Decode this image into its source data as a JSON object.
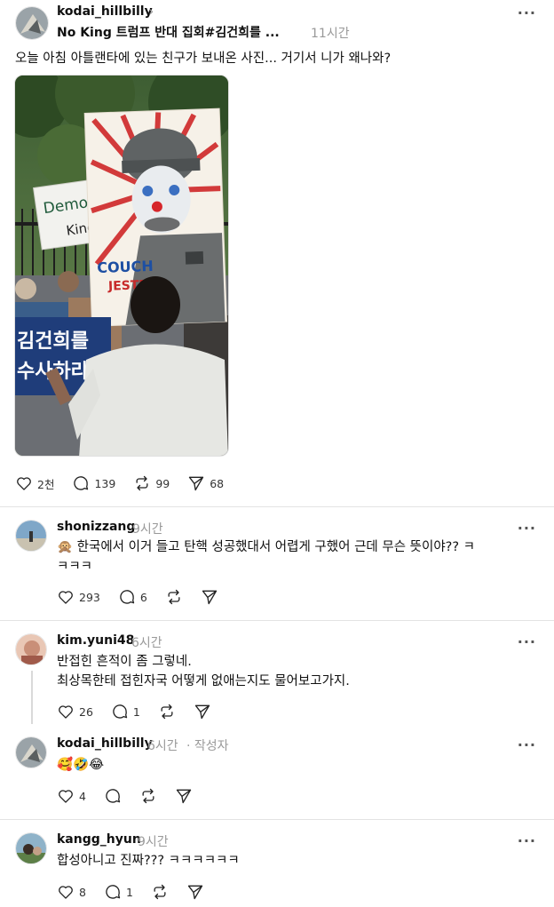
{
  "post": {
    "username": "kodai_hillbilly",
    "title": "No King 트럼프 반대 집회#김건희를 ...",
    "time": "11시간",
    "text": "오늘 아침 아틀랜타에 있는 친구가 보내온 사진... 거기서 니가 왜나와?",
    "image_text": {
      "sign_left_1": "Democr",
      "sign_left_2": "Kings",
      "sign_blue_1": "김건희를",
      "sign_blue_2": "수사하라!",
      "poster_1": "COUCH",
      "poster_2": "JESTER"
    },
    "stats": {
      "likes": "2천",
      "comments": "139",
      "reposts": "99",
      "shares": "68"
    }
  },
  "comments": [
    {
      "username": "shonizzang",
      "time": "9시간",
      "text_line1": "🙊 한국에서 이거 들고 탄핵 성공했대서 어렵게 구했어 근데 무슨 뜻이야?? ㅋ",
      "text_line2": "ㅋㅋㅋ",
      "likes": "293",
      "comments": "6"
    },
    {
      "username": "kim.yuni48",
      "time": "6시간",
      "text_line1": "반접힌 흔적이 좀 그렇네.",
      "text_line2": "최상목한테 접힌자국 어떻게 없애는지도 물어보고가지.",
      "likes": "26",
      "comments": "1"
    },
    {
      "username": "kodai_hillbilly",
      "time": "6시간",
      "author_tag": "· 작성자",
      "text_line1": "🥰🤣😂",
      "likes": "4"
    },
    {
      "username": "kangg_hyun",
      "time": "9시간",
      "text_line1": "합성아니고 진짜??? ㅋㅋㅋㅋㅋㅋ",
      "likes": "8",
      "comments": "1"
    }
  ],
  "ui": {
    "more": "···",
    "chevron": "›"
  },
  "colors": {
    "text": "#101010",
    "muted": "#999999",
    "divider": "#e3e3e3",
    "sign_blue": "#1f3d7a"
  }
}
